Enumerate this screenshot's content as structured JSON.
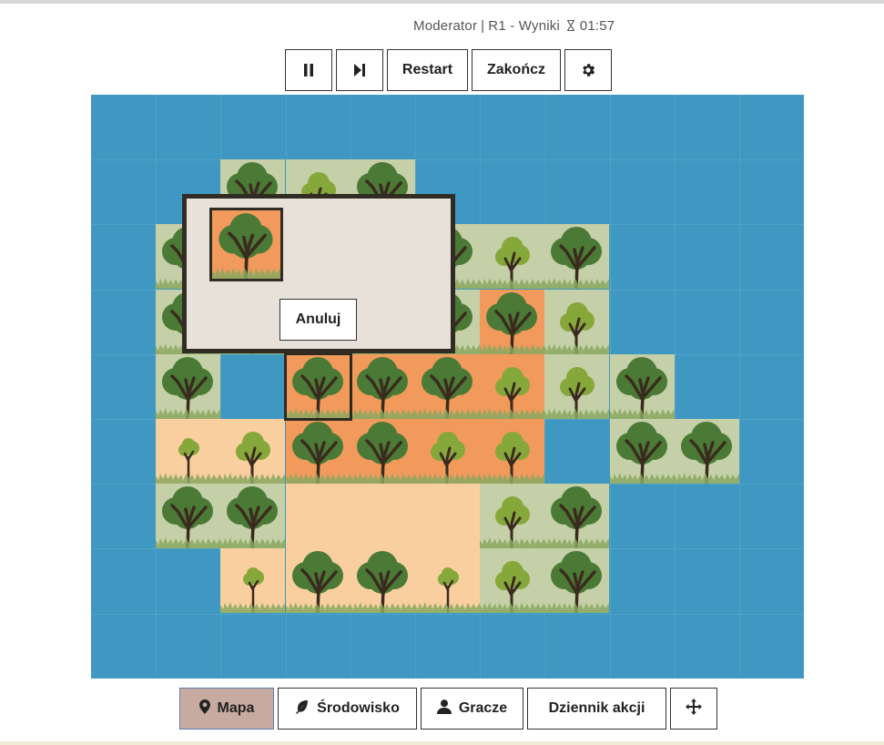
{
  "header": {
    "role": "Moderator",
    "round": "R1 - Wyniki",
    "timer_icon": "hourglass-icon",
    "timer": "01:57"
  },
  "toolbar": {
    "pause_icon": "pause-icon",
    "next_icon": "skip-next-icon",
    "restart_label": "Restart",
    "end_label": "Zakończ",
    "settings_icon": "gear-icon"
  },
  "colors": {
    "water": "#3f98c2",
    "grass": "#c5cfa8",
    "sand": "#f9cfa0",
    "orange": "#f19a5c",
    "tree_dark": "#4b7a36",
    "tree_light": "#86a83a",
    "trunk": "#3a2b1e",
    "nav_active": "#c8aba0"
  },
  "board": {
    "rows": [
      "..........",
      "...gG.g....",
      "..g..g.gG...",
      "..g...gEgG..",
      "..gwSEeEeG...",
      "..eeSEEESwGG",
      "..gg....ggG.",
      "..seGGsGG...",
      ".........."
    ],
    "selected": "row 4, col 3"
  },
  "dialog": {
    "cancel_label": "Anuluj"
  },
  "nav": {
    "map_label": "Mapa",
    "map_icon": "map-pin-icon",
    "env_label": "Środowisko",
    "env_icon": "leaf-icon",
    "players_label": "Gracze",
    "players_icon": "user-icon",
    "log_label": "Dziennik akcji",
    "move_icon": "move-arrows-icon"
  }
}
